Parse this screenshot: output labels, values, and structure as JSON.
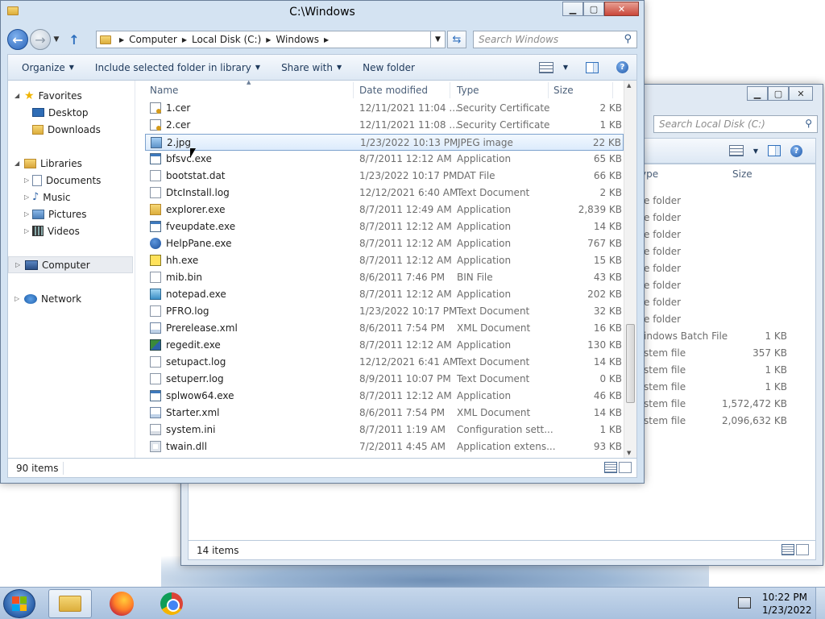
{
  "back_window": {
    "search_placeholder": "Search Local Disk (C:)",
    "columns": {
      "type": "ype",
      "size": "Size"
    },
    "rows": [
      {
        "type": "e folder",
        "size": ""
      },
      {
        "type": "e folder",
        "size": ""
      },
      {
        "type": "e folder",
        "size": ""
      },
      {
        "type": "e folder",
        "size": ""
      },
      {
        "type": "e folder",
        "size": ""
      },
      {
        "type": "e folder",
        "size": ""
      },
      {
        "type": "e folder",
        "size": ""
      },
      {
        "type": "e folder",
        "size": ""
      },
      {
        "type": "indows Batch File",
        "size": "1 KB"
      },
      {
        "type": "stem file",
        "size": "357 KB"
      },
      {
        "type": "stem file",
        "size": "1 KB"
      },
      {
        "type": "stem file",
        "size": "1 KB"
      },
      {
        "type": "stem file",
        "size": "1,572,472 KB"
      },
      {
        "type": "stem file",
        "size": "2,096,632 KB"
      }
    ],
    "status": "14 items"
  },
  "main_window": {
    "title": "C:\\Windows",
    "breadcrumb": [
      "Computer",
      "Local Disk (C:)",
      "Windows"
    ],
    "search_placeholder": "Search Windows",
    "toolbar": {
      "organize": "Organize",
      "include": "Include selected folder in library",
      "share": "Share with",
      "new_folder": "New folder"
    },
    "nav": {
      "favorites": "Favorites",
      "desktop": "Desktop",
      "downloads": "Downloads",
      "libraries": "Libraries",
      "documents": "Documents",
      "music": "Music",
      "pictures": "Pictures",
      "videos": "Videos",
      "computer": "Computer",
      "network": "Network"
    },
    "columns": {
      "name": "Name",
      "date": "Date modified",
      "type": "Type",
      "size": "Size"
    },
    "files": [
      {
        "name": "1.cer",
        "date": "12/11/2021 11:04 ...",
        "type": "Security Certificate",
        "size": "2 KB",
        "icon": "cert"
      },
      {
        "name": "2.cer",
        "date": "12/11/2021 11:08 ...",
        "type": "Security Certificate",
        "size": "1 KB",
        "icon": "cert"
      },
      {
        "name": "2.jpg",
        "date": "1/23/2022 10:13 PM",
        "type": "JPEG image",
        "size": "22 KB",
        "icon": "img"
      },
      {
        "name": "bfsvc.exe",
        "date": "8/7/2011 12:12 AM",
        "type": "Application",
        "size": "65 KB",
        "icon": "app"
      },
      {
        "name": "bootstat.dat",
        "date": "1/23/2022 10:17 PM",
        "type": "DAT File",
        "size": "66 KB",
        "icon": "doc"
      },
      {
        "name": "DtcInstall.log",
        "date": "12/12/2021 6:40 AM",
        "type": "Text Document",
        "size": "2 KB",
        "icon": "doc"
      },
      {
        "name": "explorer.exe",
        "date": "8/7/2011 12:49 AM",
        "type": "Application",
        "size": "2,839 KB",
        "icon": "folderapp"
      },
      {
        "name": "fveupdate.exe",
        "date": "8/7/2011 12:12 AM",
        "type": "Application",
        "size": "14 KB",
        "icon": "app"
      },
      {
        "name": "HelpPane.exe",
        "date": "8/7/2011 12:12 AM",
        "type": "Application",
        "size": "767 KB",
        "icon": "help"
      },
      {
        "name": "hh.exe",
        "date": "8/7/2011 12:12 AM",
        "type": "Application",
        "size": "15 KB",
        "icon": "hh"
      },
      {
        "name": "mib.bin",
        "date": "8/6/2011 7:46 PM",
        "type": "BIN File",
        "size": "43 KB",
        "icon": "doc"
      },
      {
        "name": "notepad.exe",
        "date": "8/7/2011 12:12 AM",
        "type": "Application",
        "size": "202 KB",
        "icon": "note"
      },
      {
        "name": "PFRO.log",
        "date": "1/23/2022 10:17 PM",
        "type": "Text Document",
        "size": "32 KB",
        "icon": "doc"
      },
      {
        "name": "Prerelease.xml",
        "date": "8/6/2011 7:54 PM",
        "type": "XML Document",
        "size": "16 KB",
        "icon": "xml"
      },
      {
        "name": "regedit.exe",
        "date": "8/7/2011 12:12 AM",
        "type": "Application",
        "size": "130 KB",
        "icon": "reg"
      },
      {
        "name": "setupact.log",
        "date": "12/12/2021 6:41 AM",
        "type": "Text Document",
        "size": "14 KB",
        "icon": "doc"
      },
      {
        "name": "setuperr.log",
        "date": "8/9/2011 10:07 PM",
        "type": "Text Document",
        "size": "0 KB",
        "icon": "doc"
      },
      {
        "name": "splwow64.exe",
        "date": "8/7/2011 12:12 AM",
        "type": "Application",
        "size": "46 KB",
        "icon": "app"
      },
      {
        "name": "Starter.xml",
        "date": "8/6/2011 7:54 PM",
        "type": "XML Document",
        "size": "14 KB",
        "icon": "xml"
      },
      {
        "name": "system.ini",
        "date": "8/7/2011 1:19 AM",
        "type": "Configuration sett...",
        "size": "1 KB",
        "icon": "ini"
      },
      {
        "name": "twain.dll",
        "date": "7/2/2011 4:45 AM",
        "type": "Application extens...",
        "size": "93 KB",
        "icon": "dll"
      }
    ],
    "selected_file": "2.jpg",
    "status": "90 items"
  },
  "taskbar": {
    "time": "10:22 PM",
    "date": "1/23/2022"
  },
  "colors": {
    "selection": "#dcebfc",
    "selection_border": "#7da2ce",
    "frame": "#d4e3f2",
    "taskbar": "#b9cde5"
  }
}
